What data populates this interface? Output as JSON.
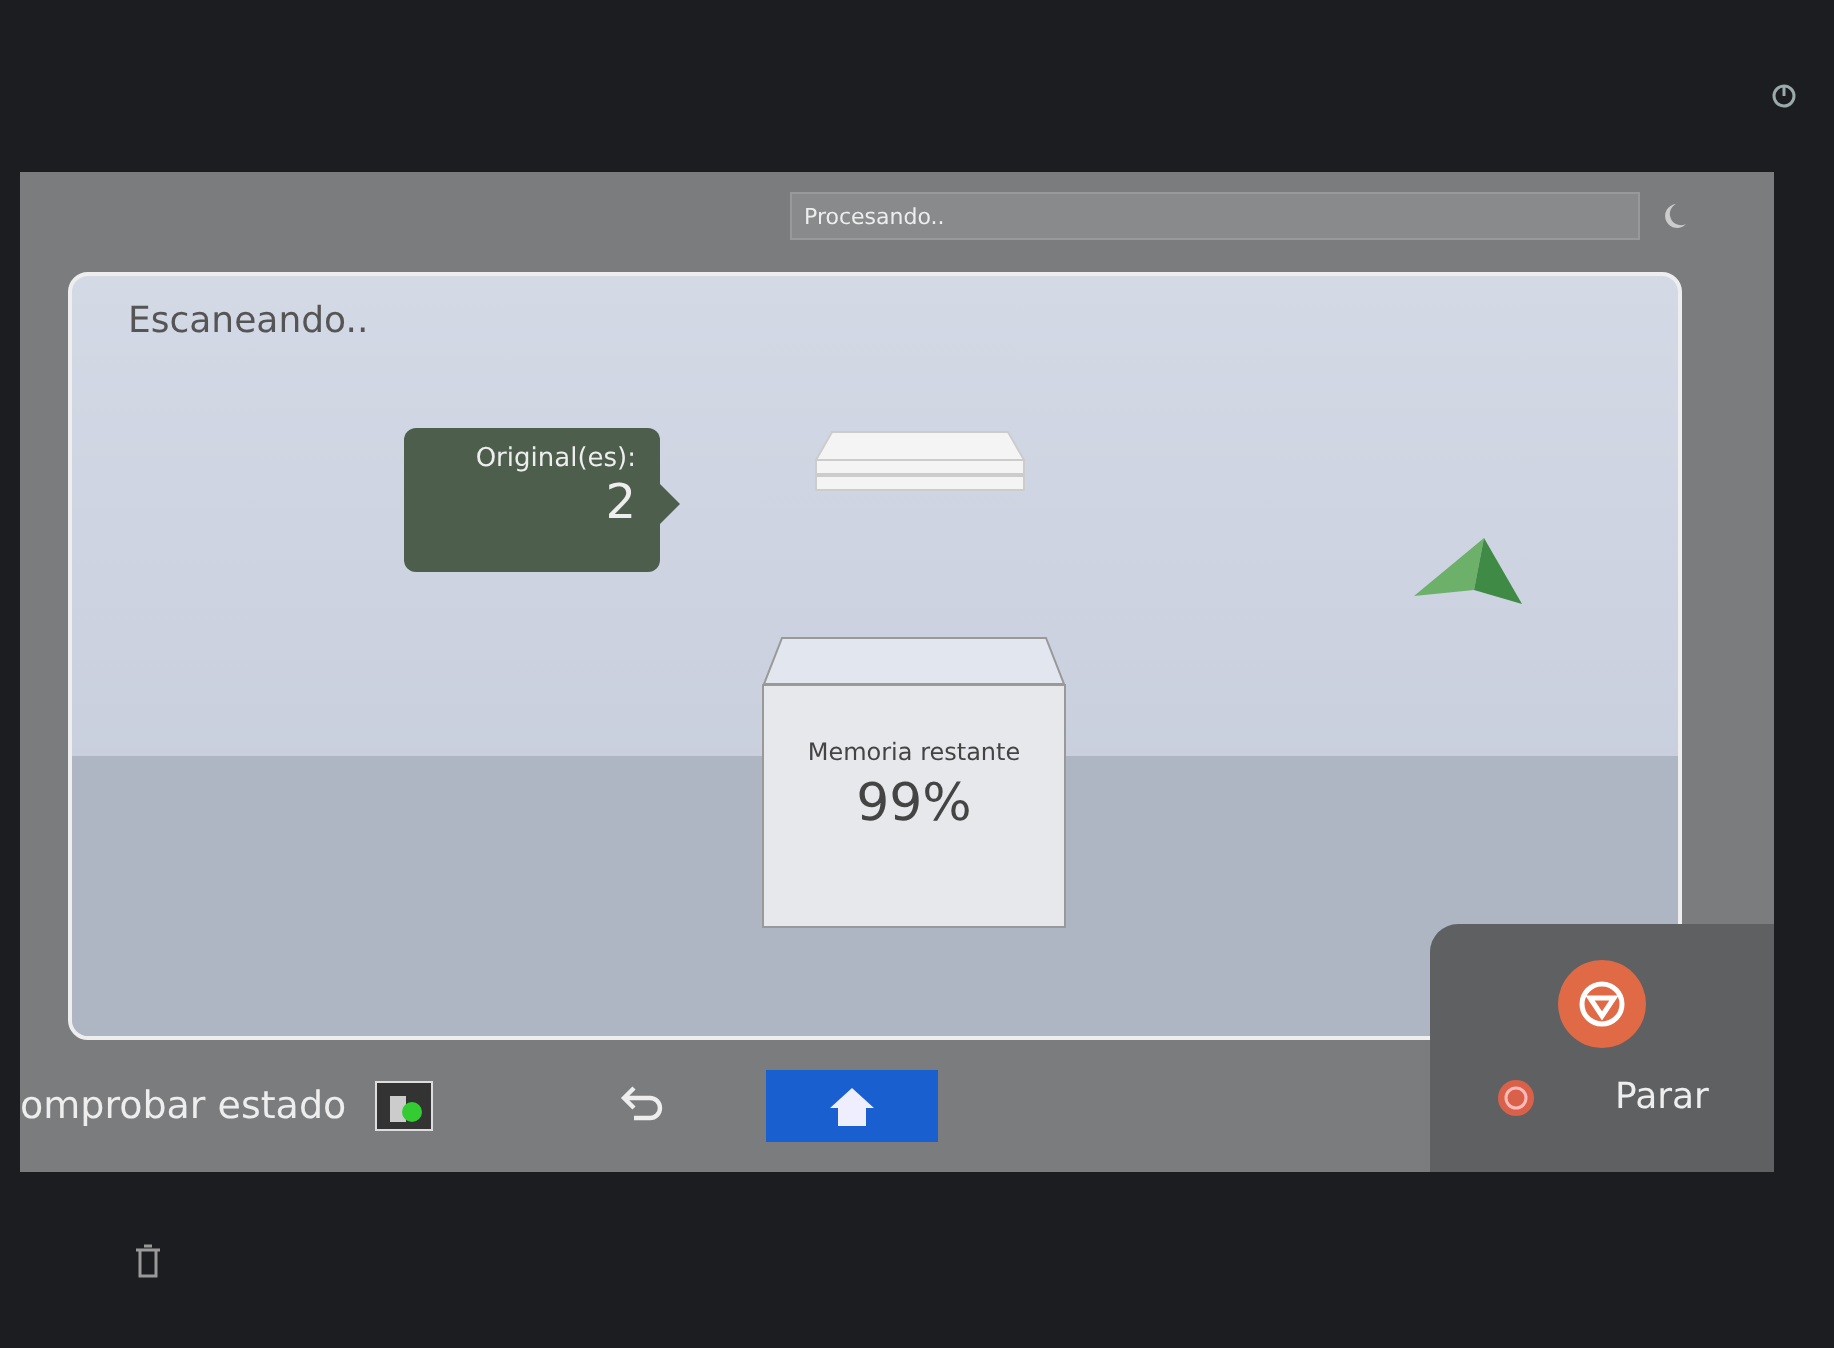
{
  "status_bar": {
    "message": "Procesando.."
  },
  "panel": {
    "title": "Escaneando..",
    "originals_label": "Original(es):",
    "originals_count": "2",
    "memory_label": "Memoria restante",
    "memory_value": "99%"
  },
  "bottom_bar": {
    "status_label": "omprobar estado"
  },
  "stop_panel": {
    "label": "Parar"
  }
}
